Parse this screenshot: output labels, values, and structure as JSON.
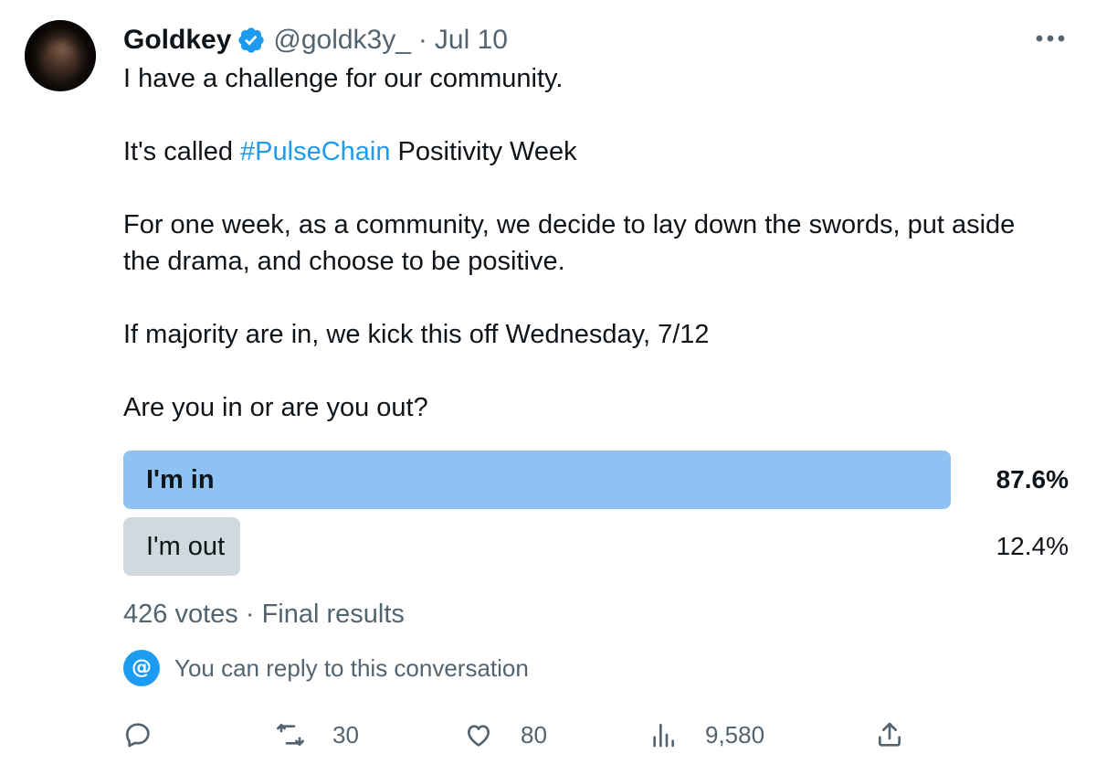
{
  "tweet": {
    "author": {
      "display_name": "Goldkey",
      "handle": "@goldk3y_",
      "verified": true,
      "avatar_icon": "user-avatar"
    },
    "separator": "·",
    "date": "Jul 10",
    "text": {
      "line1": "I have a challenge for our community.",
      "line2_prefix": "It's called ",
      "line2_hashtag": "#PulseChain",
      "line2_suffix": " Positivity Week",
      "line3": "For one week, as a community, we decide to lay down the swords, put aside the drama, and choose to be positive.",
      "line4": "If majority are in, we kick this off Wednesday, 7/12",
      "line5": "Are you in or are you out?"
    }
  },
  "poll": {
    "options": [
      {
        "label": "I'm in",
        "percent_label": "87.6%",
        "percent": 87.6,
        "winner": true
      },
      {
        "label": "I'm out",
        "percent_label": "12.4%",
        "percent": 12.4,
        "winner": false
      }
    ],
    "votes": "426 votes",
    "separator": "·",
    "status": "Final results"
  },
  "reply_note": {
    "icon": "at-icon",
    "icon_glyph": "@",
    "text": "You can reply to this conversation"
  },
  "actions": {
    "reply": {
      "icon": "reply-icon",
      "count": ""
    },
    "retweet": {
      "icon": "retweet-icon",
      "count": "30"
    },
    "like": {
      "icon": "heart-icon",
      "count": "80"
    },
    "views": {
      "icon": "views-icon",
      "count": "9,580"
    },
    "share": {
      "icon": "share-icon",
      "count": ""
    }
  },
  "colors": {
    "accent": "#1d9bf0",
    "poll_winner_fill": "#8ec2f2",
    "poll_other_fill": "#cfd9de",
    "secondary_text": "#536471",
    "primary_text": "#0f1419"
  }
}
